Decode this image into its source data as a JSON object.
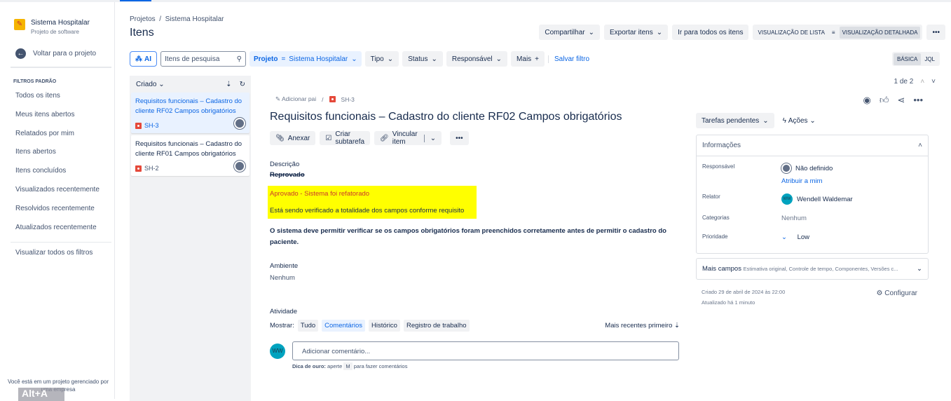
{
  "sidebar": {
    "project_name": "Sistema Hospitalar",
    "project_type": "Projeto de software",
    "back": "Voltar para o projeto",
    "section": "FILTROS PADRÃO",
    "items": [
      "Todos os itens",
      "Meus itens abertos",
      "Relatados por mim",
      "Itens abertos",
      "Itens concluídos",
      "Visualizados recentemente",
      "Resolvidos recentemente",
      "Atualizados recentemente"
    ],
    "all_filters": "Visualizar todos os filtros",
    "footer": "Você está em um projeto gerenciado por uma empresa",
    "shortcut": "Alt+A"
  },
  "header": {
    "breadcrumb": [
      "Projetos",
      "/",
      "Sistema Hospitalar"
    ],
    "title": "Itens",
    "share": "Compartilhar",
    "export": "Exportar itens",
    "all_items": "Ir para todos os itens",
    "list_view": "VISUALIZAÇÃO DE LISTA",
    "detail_view": "VISUALIZAÇÃO DETALHADA",
    "more": "•••"
  },
  "filters": {
    "ai": "AI",
    "search_placeholder": "Itens de pesquisa",
    "project_label": "Projeto",
    "project_op": "=",
    "project_value": "Sistema Hospitalar",
    "type": "Tipo",
    "status": "Status",
    "assignee": "Responsável",
    "more": "Mais",
    "save": "Salvar filtro",
    "basic": "BÁSICA",
    "jql": "JQL"
  },
  "list": {
    "sort": "Criado",
    "cards": [
      {
        "title": "Requisitos funcionais – Cadastro do cliente RF02 Campos obrigatórios",
        "key": "SH-3"
      },
      {
        "title": "Requisitos funcionais – Cadastro do cliente RF01 Campos obrigatórios",
        "key": "SH-2"
      }
    ]
  },
  "pager": {
    "text": "1 de 2"
  },
  "issue": {
    "add_parent": "Adicionar pai",
    "sep": "/",
    "key": "SH-3",
    "title": "Requisitos funcionais – Cadastro do cliente RF02 Campos obrigatórios",
    "attach": "Anexar",
    "subtask": "Criar subtarefa",
    "link": "Vincular item",
    "desc_label": "Descrição",
    "rejected": "Reprovado ",
    "approved": "Aprovado - Sistema foi refatorado",
    "verifying": "Está sendo verificado a totalidade dos campos conforme requisito",
    "body": "O sistema deve permitir verificar se os campos obrigatórios foram preenchidos corretamente antes de permitir o cadastro do paciente.",
    "env_label": "Ambiente",
    "env_value": "Nenhum"
  },
  "activity": {
    "label": "Atividade",
    "show": "Mostrar:",
    "tabs": [
      "Tudo",
      "Comentários",
      "Histórico",
      "Registro de trabalho"
    ],
    "order": "Mais recentes primeiro",
    "avatar": "WW",
    "placeholder": "Adicionar comentário...",
    "tip_bold": "Dica de ouro:",
    "tip_a": "aperte",
    "tip_key": "M",
    "tip_b": "para fazer comentários"
  },
  "details": {
    "pending": "Tarefas pendentes",
    "actions": "Ações",
    "panel": "Informações",
    "assignee_label": "Responsável",
    "assignee": "Não definido",
    "assign_me": "Atribuir a mim",
    "reporter_label": "Relator",
    "reporter_initials": "WW",
    "reporter": "Wendell Waldemar",
    "categories_label": "Categorias",
    "categories": "Nenhum",
    "priority_label": "Prioridade",
    "priority": "Low",
    "more_fields": "Mais campos",
    "more_fields_hint": "Estimativa original, Controle de tempo, Componentes, Versões c...",
    "created": "Criado 29 de abril de 2024 às 22:00",
    "updated": "Atualizado há 1 minuto",
    "configure": "Configurar"
  },
  "colors": {
    "accent": "#0c66e4",
    "highlight": "#ffff00",
    "approved_text": "#c9372c",
    "bug": "#e5493a"
  }
}
